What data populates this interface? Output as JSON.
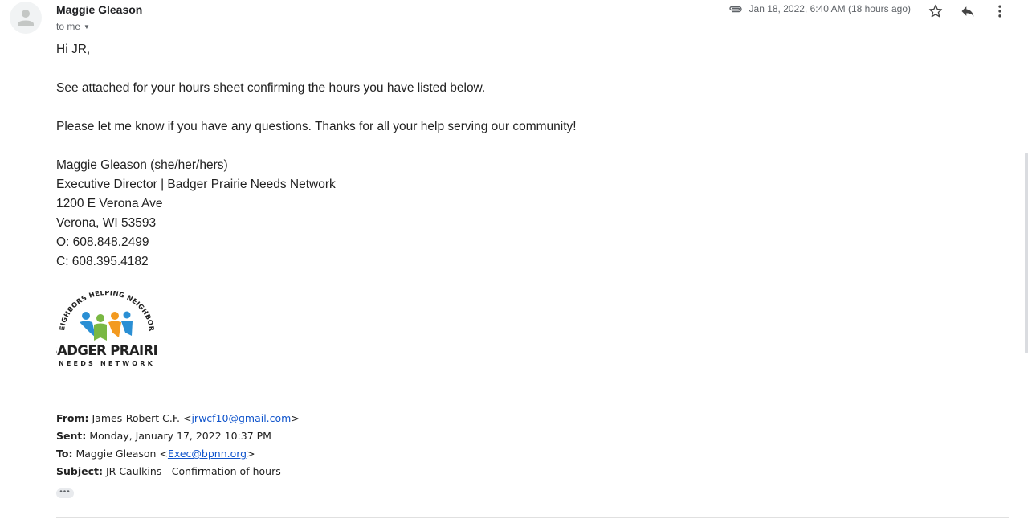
{
  "email": {
    "sender_name": "Maggie Gleason",
    "recipient_line": "to me",
    "date": "Jan 18, 2022, 6:40 AM (18 hours ago)",
    "icons": [
      "attachment-icon",
      "star-icon",
      "reply-icon",
      "more-options-icon"
    ]
  },
  "body": {
    "greeting": "Hi JR,",
    "line1": "See attached for your hours sheet confirming the hours you have listed below.",
    "line2": "Please let me know if you have any questions. Thanks for all your help serving our community!",
    "signature": {
      "name": "Maggie Gleason (she/her/hers)",
      "title": "Executive Director | Badger Prairie Needs Network",
      "address1": "1200 E Verona Ave",
      "address2": "Verona, WI 53593",
      "office": "O: 608.848.2499",
      "cell": "C: 608.395.4182"
    },
    "logo": {
      "arc_text": "NEIGHBORS HELPING NEIGHBORS",
      "main_text": "BADGER PRAIRIE",
      "sub_text": "NEEDS NETWORK"
    }
  },
  "forwarded": {
    "from_label": "From:",
    "from_name": "James-Robert C.F. <",
    "from_email": "jrwcf10@gmail.com",
    "from_close": ">",
    "sent_label": "Sent:",
    "sent_value": "Monday, January 17, 2022 10:37 PM",
    "to_label": "To:",
    "to_name": "Maggie Gleason <",
    "to_email": "Exec@bpnn.org",
    "to_close": ">",
    "subject_label": "Subject:",
    "subject_value": "JR Caulkins - Confirmation of hours",
    "ellipsis": "•••"
  },
  "colors": {
    "link": "#1155cc",
    "logo_blue": "#2a8fd4",
    "logo_green": "#7ab843",
    "logo_orange": "#f39a1f"
  }
}
